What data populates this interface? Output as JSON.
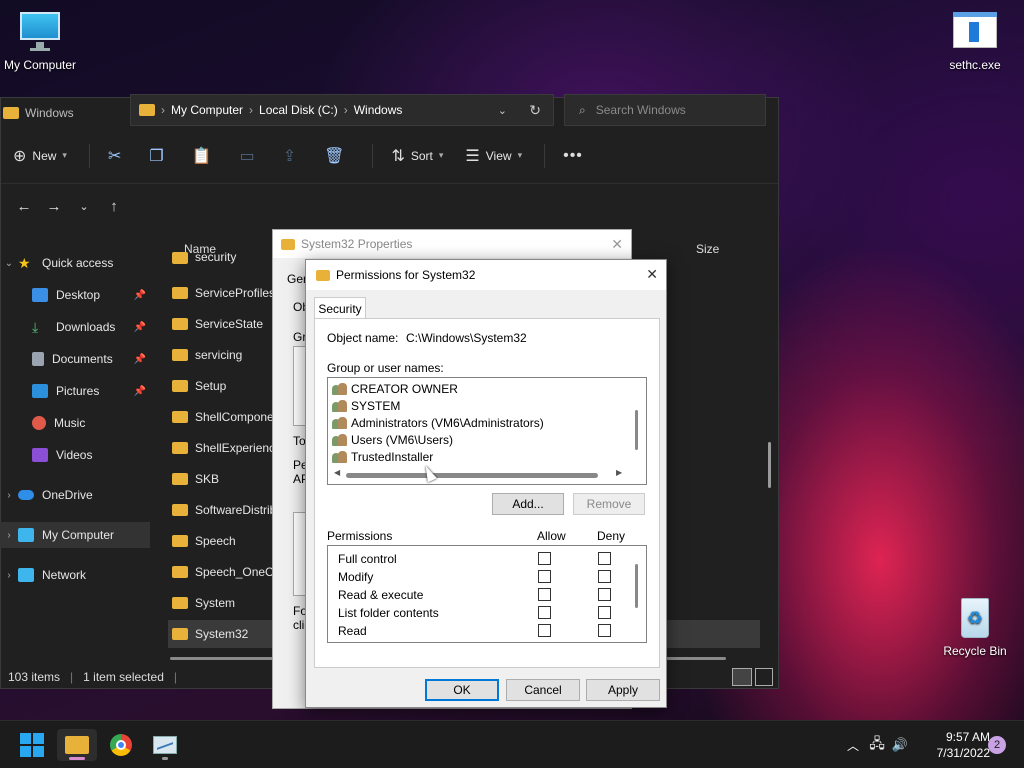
{
  "desktop": {
    "icons": [
      {
        "label": "My Computer"
      },
      {
        "label": "sethc.exe"
      },
      {
        "label": "Recycle Bin"
      }
    ]
  },
  "explorer": {
    "title": "Windows",
    "toolbar": {
      "new_label": "New",
      "sort_label": "Sort",
      "view_label": "View"
    },
    "address": {
      "crumbs": [
        "My Computer",
        "Local Disk (C:)",
        "Windows"
      ]
    },
    "search_placeholder": "Search Windows",
    "sidebar": [
      {
        "label": "Quick access"
      },
      {
        "label": "Desktop"
      },
      {
        "label": "Downloads"
      },
      {
        "label": "Documents"
      },
      {
        "label": "Pictures"
      },
      {
        "label": "Music"
      },
      {
        "label": "Videos"
      },
      {
        "label": "OneDrive"
      },
      {
        "label": "My Computer"
      },
      {
        "label": "Network"
      }
    ],
    "columns": {
      "name": "Name",
      "size": "Size"
    },
    "files": [
      "security",
      "ServiceProfiles",
      "ServiceState",
      "servicing",
      "Setup",
      "ShellComponents",
      "ShellExperiences",
      "SKB",
      "SoftwareDistribution",
      "Speech",
      "Speech_OneCore",
      "System",
      "System32"
    ],
    "status": {
      "count": "103 items",
      "selected": "1 item selected"
    }
  },
  "properties": {
    "title": "System32 Properties",
    "fragments": [
      "Gen",
      "Ob",
      "Gro",
      "To",
      "Pe",
      "AP",
      "For",
      "clic"
    ]
  },
  "permissions": {
    "title": "Permissions for System32",
    "tab": "Security",
    "object_label": "Object name:",
    "object_value": "C:\\Windows\\System32",
    "group_label": "Group or user names:",
    "users": [
      "CREATOR OWNER",
      "SYSTEM",
      "Administrators (VM6\\Administrators)",
      "Users (VM6\\Users)",
      "TrustedInstaller"
    ],
    "add_label": "Add...",
    "remove_label": "Remove",
    "perm_label": "Permissions",
    "allow_label": "Allow",
    "deny_label": "Deny",
    "perms": [
      "Full control",
      "Modify",
      "Read & execute",
      "List folder contents",
      "Read"
    ],
    "ok_label": "OK",
    "cancel_label": "Cancel",
    "apply_label": "Apply"
  },
  "taskbar": {
    "time": "9:57 AM",
    "date": "7/31/2022",
    "badge": "2"
  },
  "colors": {
    "accent": "#0078d7",
    "folder": "#e8b23a"
  }
}
